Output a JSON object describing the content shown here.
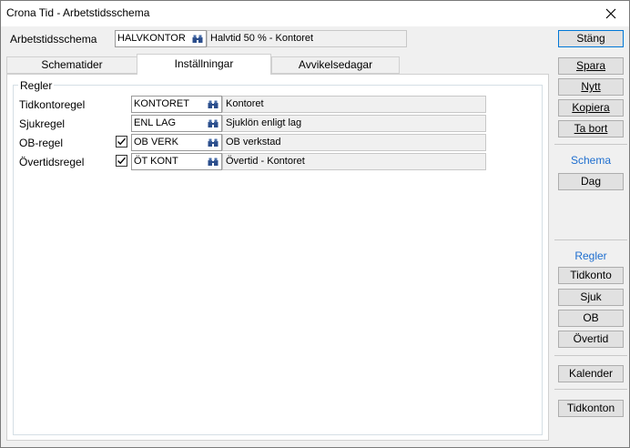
{
  "window": {
    "title": "Crona Tid - Arbetstidsschema"
  },
  "header": {
    "label": "Arbetstidsschema",
    "code": "HALVKONTOR",
    "description": "Halvtid 50 % - Kontoret",
    "close_label": "Stäng"
  },
  "tabs": [
    {
      "label": "Schematider"
    },
    {
      "label": "Inställningar"
    },
    {
      "label": "Avvikelsedagar"
    }
  ],
  "rules": {
    "group_title": "Regler",
    "rows": [
      {
        "label": "Tidkontoregel",
        "checked": null,
        "code": "KONTORET",
        "description": "Kontoret"
      },
      {
        "label": "Sjukregel",
        "checked": null,
        "code": "ENL LAG",
        "description": "Sjuklön enligt lag"
      },
      {
        "label": "OB-regel",
        "checked": true,
        "code": "OB VERK",
        "description": "OB verkstad"
      },
      {
        "label": "Övertidsregel",
        "checked": true,
        "code": "ÖT KONT",
        "description": "Övertid - Kontoret"
      }
    ]
  },
  "sidebar": {
    "save": "Spara",
    "new": "Nytt",
    "copy": "Kopiera",
    "delete": "Ta bort",
    "schema_title": "Schema",
    "day": "Dag",
    "rules_title": "Regler",
    "tidkonto": "Tidkonto",
    "sjuk": "Sjuk",
    "ob": "OB",
    "overtid": "Övertid",
    "kalender": "Kalender",
    "tidkonton": "Tidkonton"
  },
  "colors": {
    "accent": "#1e6ecf",
    "focus_border": "#0078d7"
  },
  "icons": {
    "lookup": "binoculars-icon",
    "close": "close-icon",
    "check": "checkmark-icon"
  }
}
